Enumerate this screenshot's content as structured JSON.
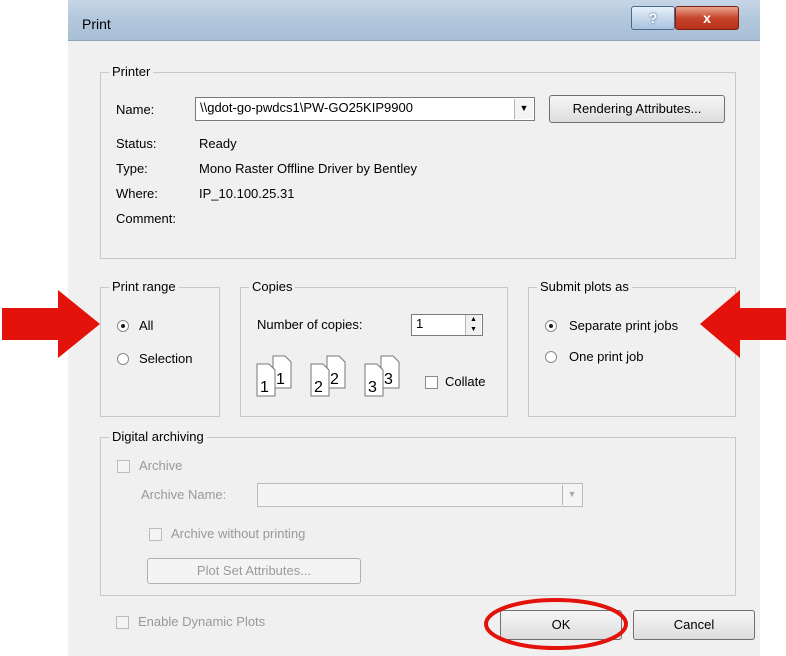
{
  "window": {
    "title": "Print",
    "help_label": "?",
    "close_label": "x"
  },
  "printer": {
    "legend": "Printer",
    "name_label": "Name:",
    "name_value": "\\\\gdot-go-pwdcs1\\PW-GO25KIP9900",
    "rendering_button": "Rendering Attributes...",
    "status_label": "Status:",
    "status_value": "Ready",
    "type_label": "Type:",
    "type_value": "Mono Raster Offline Driver by Bentley",
    "where_label": "Where:",
    "where_value": "IP_10.100.25.31",
    "comment_label": "Comment:"
  },
  "print_range": {
    "legend": "Print range",
    "all": "All",
    "selection": "Selection",
    "selected": "all"
  },
  "copies": {
    "legend": "Copies",
    "number_label": "Number of copies:",
    "number_value": "1",
    "collate_label": "Collate",
    "collate_checked": false,
    "page_icons": [
      {
        "big": "1",
        "small": "1"
      },
      {
        "big": "2",
        "small": "2"
      },
      {
        "big": "3",
        "small": "3"
      }
    ]
  },
  "submit": {
    "legend": "Submit plots as",
    "separate": "Separate print jobs",
    "one": "One print job",
    "selected": "separate"
  },
  "archiving": {
    "legend": "Digital archiving",
    "archive_label": "Archive",
    "archive_name_label": "Archive Name:",
    "archive_name_value": "",
    "without_printing_label": "Archive without printing",
    "plot_set_button": "Plot Set Attributes..."
  },
  "footer": {
    "dynamic_plots_label": "Enable Dynamic Plots",
    "ok_label": "OK",
    "cancel_label": "Cancel"
  },
  "annotations": {
    "arrow_color": "#e3120b",
    "ellipse_color": "#e3120b"
  }
}
